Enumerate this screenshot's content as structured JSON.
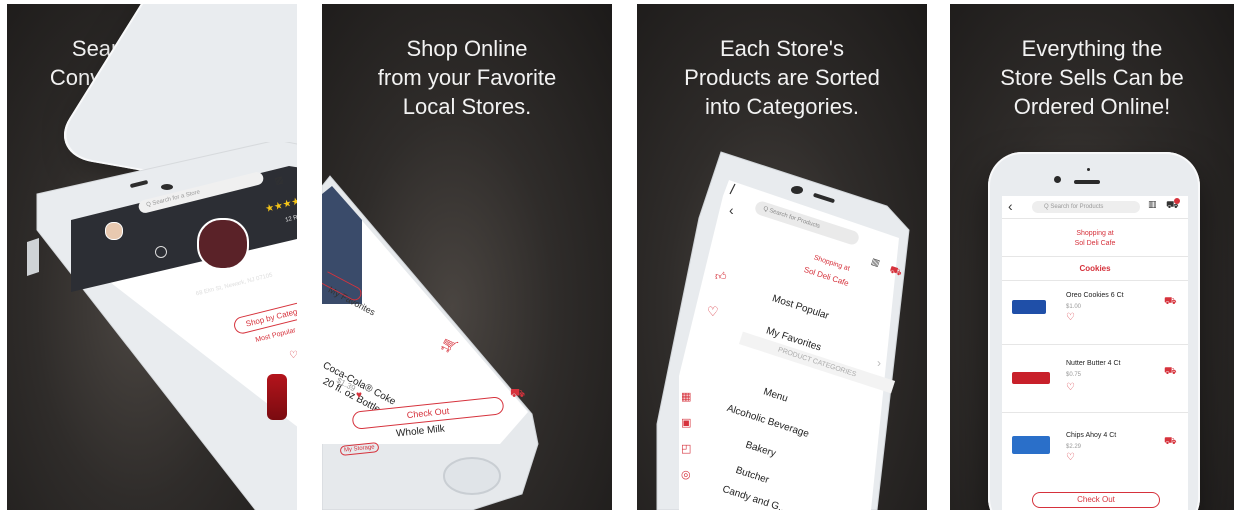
{
  "panels": [
    {
      "caption": [
        "Search for Local",
        "Convenience Stores."
      ],
      "search_placeholder": "Q Search for a Store",
      "stars": "★★★★",
      "reviews": "12 Reviews",
      "store_name": "Sol Deli Cafe",
      "store_address": "68 Elm St, Newark, NJ 07105",
      "shop_by_category": "Shop by Category",
      "most_popular": "Most Popular",
      "my_favorites": "My Favorites"
    },
    {
      "caption": [
        "Shop Online",
        "from your Favorite",
        "Local Stores."
      ],
      "my_favorites": "My Favorites",
      "product_name_line1": "Coca-Cola® Coke",
      "product_name_line2": "20 fl. oz Bottle",
      "product_price": "$1.39",
      "check_out": "Check Out",
      "next_item": "Whole Milk",
      "badge": "My Storage"
    },
    {
      "caption": [
        "Each Store's",
        "Products are Sorted",
        "into Categories."
      ],
      "search_placeholder": "Q Search for Products",
      "shopping_at": "Shopping at",
      "store_name": "Sol Deli Cafe",
      "menu_items": [
        "Most Popular",
        "My Favorites"
      ],
      "section_header": "PRODUCT CATEGORIES",
      "categories": [
        "Menu",
        "Alcoholic Beverage",
        "Bakery",
        "Butcher",
        "Candy and G..."
      ]
    },
    {
      "caption": [
        "Everything the",
        "Store Sells Can be",
        "Ordered Online!"
      ],
      "search_placeholder": "Q Search for Products",
      "shopping_at": "Shopping at",
      "store_name": "Sol Deli Cafe",
      "category": "Cookies",
      "products": [
        {
          "name": "Oreo Cookies 6 Ct",
          "price": "$1.00",
          "pack_color": "#1f4fa8"
        },
        {
          "name": "Nutter Butter 4 Ct",
          "price": "$0.75",
          "pack_color": "#c8202a"
        },
        {
          "name": "Chips Ahoy 4 Ct",
          "price": "$2.29",
          "pack_color": "#2a6fc9"
        }
      ],
      "check_out": "Check Out"
    }
  ],
  "colors": {
    "accent": "#d6323c",
    "panel_bg": "#2b2826",
    "phone_body": "#e9ecef"
  },
  "icons": [
    "barcode-icon",
    "cart-icon",
    "heart-icon",
    "back-chevron-icon",
    "thumbs-up-icon",
    "search-icon"
  ]
}
